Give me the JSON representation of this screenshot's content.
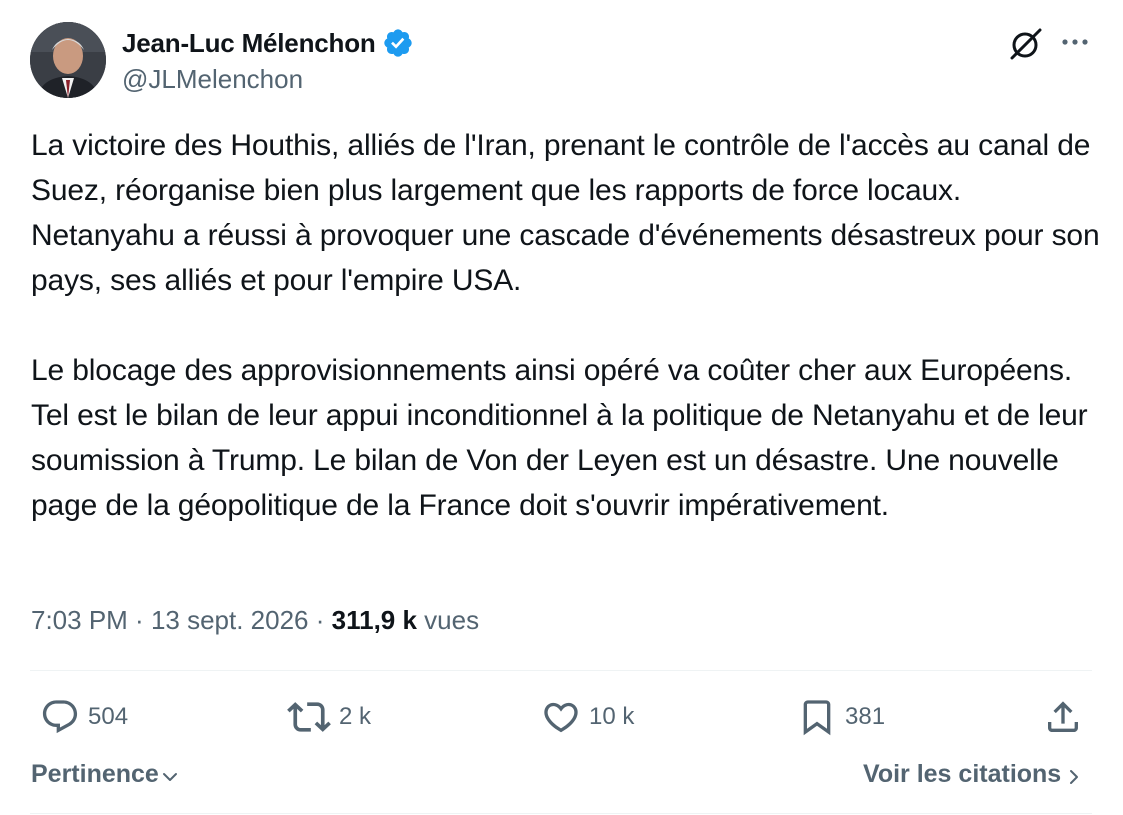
{
  "author": {
    "display_name": "Jean-Luc Mélenchon",
    "handle": "@JLMelenchon",
    "verified": true,
    "verified_color": "#1d9bf0"
  },
  "header_icons": {
    "grok": "grok-icon",
    "more": "more-icon"
  },
  "tweet": {
    "paragraphs": [
      "La victoire des Houthis, alliés de l'Iran, prenant le contrôle de l'accès au canal de Suez, réorganise bien plus largement que les rapports de force locaux. Netanyahu a réussi à provoquer une cascade d'événements désastreux pour son pays, ses alliés et pour l'empire USA.",
      "Le blocage des approvisionnements ainsi opéré va coûter cher aux Européens. Tel est le bilan de leur appui inconditionnel à la politique de Netanyahu et de leur soumission à Trump. Le bilan de Von der Leyen est un désastre. Une nouvelle page de la géopolitique de la France doit s'ouvrir impérativement."
    ]
  },
  "meta": {
    "time": "7:03 PM",
    "separator": " · ",
    "date": "13 sept. 2026",
    "views_count": "311,9 k",
    "views_label": "vues"
  },
  "actions": {
    "replies": "504",
    "retweets": "2 k",
    "likes": "10 k",
    "bookmarks": "381"
  },
  "footer": {
    "sort_label": "Pertinence",
    "quotes_label": "Voir les citations"
  },
  "colors": {
    "text_primary": "#0f1419",
    "text_secondary": "#536471",
    "divider": "#eff3f4",
    "accent": "#1d9bf0"
  }
}
